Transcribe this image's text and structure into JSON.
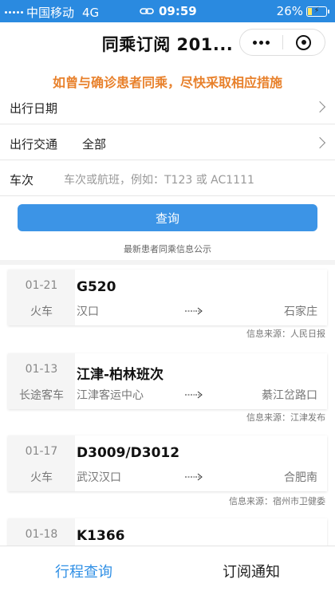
{
  "status_bar": {
    "carrier": "中国移动",
    "network": "4G",
    "time": "09:59",
    "battery": "26%",
    "battery_level": 0.26
  },
  "navbar": {
    "title": "同乘订阅 201..."
  },
  "banner": "如曾与确诊患者同乘，尽快采取相应措施",
  "form": {
    "date_label": "出行日期",
    "transport_label": "出行交通",
    "transport_value": "全部",
    "trip_label": "车次",
    "trip_placeholder": "车次或航班，例如：T123 或 AC1111"
  },
  "query_button": "查询",
  "notice": "最新患者同乘信息公示",
  "trips": [
    {
      "date": "01-21",
      "vehicle": "火车",
      "code": "G520",
      "from": "汉口",
      "to": "石家庄",
      "source": "信息来源：人民日报"
    },
    {
      "date": "01-13",
      "vehicle": "长途客车",
      "code": "江津-柏林班次",
      "from": "江津客运中心",
      "to": "綦江岔路口",
      "source": "信息来源：江津发布"
    },
    {
      "date": "01-17",
      "vehicle": "火车",
      "code": "D3009/D3012",
      "from": "武汉汉口",
      "to": "合肥南",
      "source": "信息来源：宿州市卫健委"
    },
    {
      "date": "01-18",
      "vehicle": "",
      "code": "K1366",
      "from": "",
      "to": "",
      "source": ""
    }
  ],
  "tabbar": {
    "tab1": "行程查询",
    "tab2": "订阅通知"
  },
  "colors": {
    "status_bar": "#2a8ae0",
    "accent": "#2f8fe5",
    "banner": "#e8812c"
  }
}
